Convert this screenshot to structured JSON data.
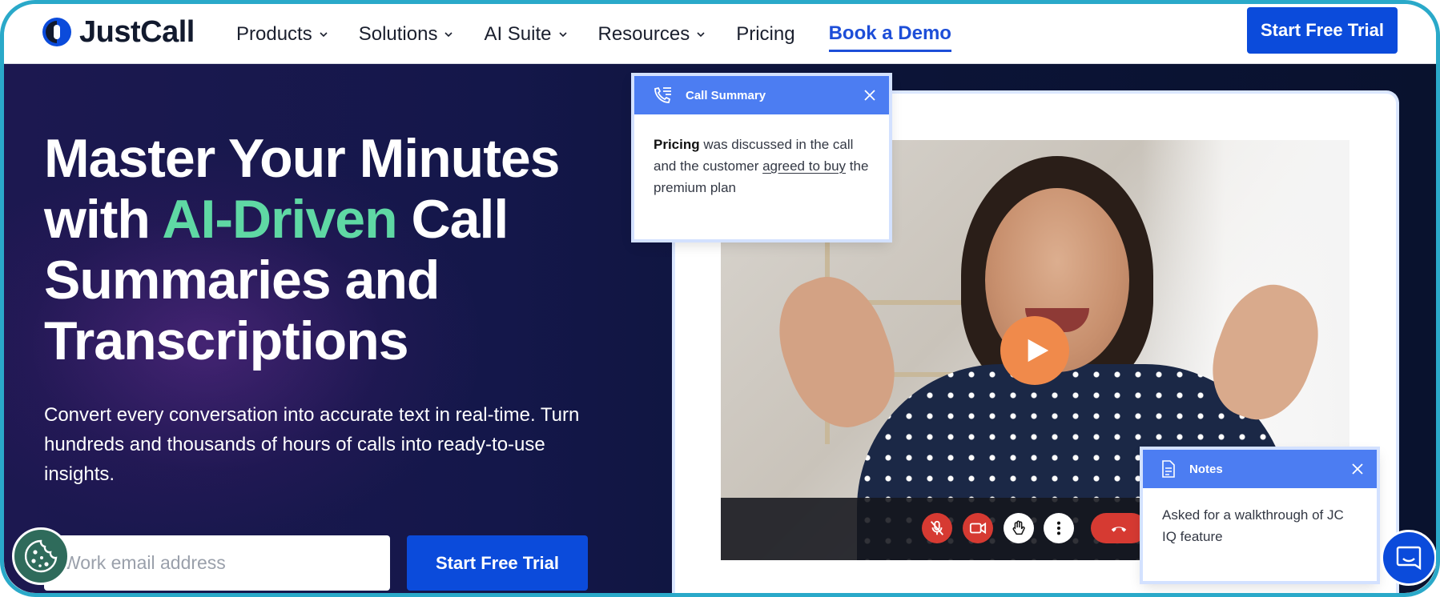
{
  "header": {
    "logo_text": "JustCall",
    "nav": [
      {
        "label": "Products",
        "has_dropdown": true
      },
      {
        "label": "Solutions",
        "has_dropdown": true
      },
      {
        "label": "AI Suite",
        "has_dropdown": true
      },
      {
        "label": "Resources",
        "has_dropdown": true
      },
      {
        "label": "Pricing",
        "has_dropdown": false
      }
    ],
    "demo_label": "Book a Demo",
    "cta_label": "Start Free Trial"
  },
  "hero": {
    "headline_part1": "Master Your Minutes with ",
    "headline_accent": "AI-Driven",
    "headline_part2": " Call Summaries and Transcriptions",
    "subtext": "Convert every conversation into accurate text in real-time. Turn hundreds and thousands of hours of calls into ready-to-use insights.",
    "email_placeholder": "Work email address",
    "cta_label": "Start Free Trial"
  },
  "call_summary": {
    "title": "Call Summary",
    "bold_word": "Pricing",
    "text_1": " was discussed in the call and the customer ",
    "underline_text": "agreed to buy",
    "text_2": " the premium plan"
  },
  "notes": {
    "title": "Notes",
    "body": "Asked for a walkthrough of JC IQ feature"
  },
  "colors": {
    "brand_blue": "#0b4bdb",
    "accent_green": "#5fd8a4",
    "card_header": "#4c7df2",
    "play_orange": "#f08a4b",
    "control_red": "#d63a32"
  },
  "icons": {
    "logo": "justcall-logo-icon",
    "dropdown": "chevron-down-icon",
    "summary": "phone-list-icon",
    "notes": "document-icon",
    "close": "close-icon",
    "play": "play-icon",
    "mute": "mic-off-icon",
    "video": "video-camera-icon",
    "hand": "raise-hand-icon",
    "more": "more-vertical-icon",
    "hangup": "phone-hangup-icon",
    "cookie": "cookie-icon",
    "chat": "chat-icon"
  }
}
